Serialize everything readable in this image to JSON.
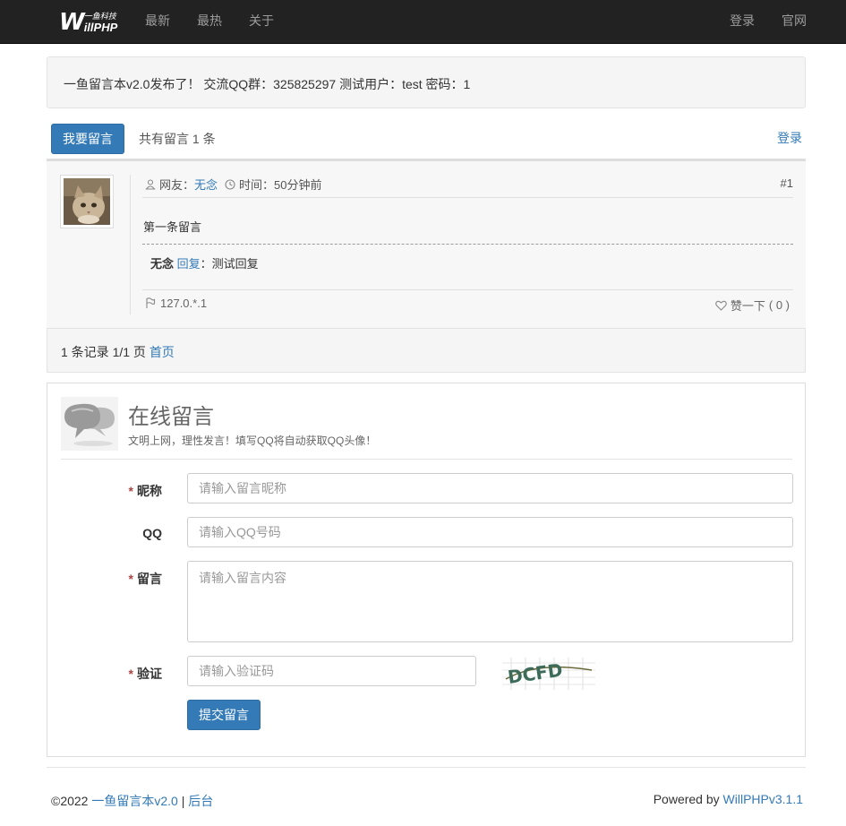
{
  "navbar": {
    "brand_mark": "W",
    "brand_cn": "一鱼科技",
    "brand_php": "illPHP",
    "links": [
      "最新",
      "最热",
      "关于"
    ],
    "right_links": [
      "登录",
      "官网"
    ]
  },
  "notice": {
    "text": "一鱼留言本v2.0发布了！ 交流QQ群：325825297 测试用户：test 密码：1"
  },
  "toolbar": {
    "post_button": "我要留言",
    "count_text": "共有留言 1 条",
    "login_link": "登录"
  },
  "message": {
    "user_label": "网友：",
    "user_name": "无念",
    "time_label": "时间：",
    "time_value": "50分钟前",
    "number": "#1",
    "content": "第一条留言",
    "reply_name": "无念",
    "reply_label": "回复",
    "reply_sep": "：",
    "reply_text": "测试回复",
    "ip": "127.0.*.1",
    "like_label": "赞一下",
    "like_count": "( 0 )"
  },
  "pagination": {
    "summary": "1 条记录 1/1 页",
    "first_page": "首页"
  },
  "form": {
    "title": "在线留言",
    "subtitle": "文明上网，理性发言！填写QQ将自动获取QQ头像！",
    "required_mark": "*",
    "nickname_label": "昵称",
    "nickname_placeholder": "请输入留言昵称",
    "qq_label": "QQ",
    "qq_placeholder": "请输入QQ号码",
    "message_label": "留言",
    "message_placeholder": "请输入留言内容",
    "captcha_label": "验证",
    "captcha_placeholder": "请输入验证码",
    "captcha_text": "DCFD",
    "submit_button": "提交留言"
  },
  "footer": {
    "copyright": "©2022 ",
    "site_link": "一鱼留言本v2.0",
    "divider": " | ",
    "admin_link": "后台",
    "powered_prefix": "Powered by ",
    "powered_link": "WillPHPv3.1.1"
  },
  "colors": {
    "navbar_bg": "#222222",
    "primary": "#337ab7",
    "required": "#a94442"
  }
}
